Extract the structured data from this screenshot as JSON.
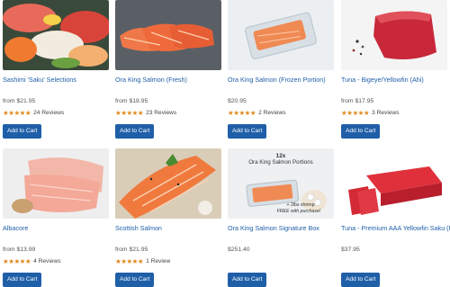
{
  "products": [
    {
      "name": "Sashimi 'Saku' Selections",
      "price": "from $21.95",
      "stars": "★★★★★",
      "reviews": "24 Reviews",
      "button": "Add to Cart"
    },
    {
      "name": "Ora King Salmon (Fresh)",
      "price": "from $18.95",
      "stars": "★★★★★",
      "reviews": "23 Reviews",
      "button": "Add to Cart"
    },
    {
      "name": "Ora King Salmon (Frozen Portion)",
      "price": "$20.95",
      "stars": "★★★★★",
      "reviews": "2 Reviews",
      "button": "Add to Cart"
    },
    {
      "name": "Tuna - Bigeye/Yellowfin (Ahi)",
      "price": "from $17.95",
      "stars": "★★★★★",
      "reviews": "3 Reviews",
      "button": "Add to Cart"
    },
    {
      "name": "Albacore",
      "price": "from $13.99",
      "stars": "★★★★★",
      "reviews": "4 Reviews",
      "button": "Add to Cart"
    },
    {
      "name": "Scottish Salmon",
      "price": "from $21.95",
      "stars": "★★★★★",
      "reviews": "1 Review",
      "button": "Add to Cart"
    },
    {
      "name": "Ora King Salmon Signature Box",
      "price": "$251.40",
      "button": "Add to Cart",
      "promo": {
        "qty": "12x",
        "title": "Ora King Salmon Portions",
        "offer": "+ 2lbs shrimp",
        "note": "FREE with purchase!"
      }
    },
    {
      "name": "Tuna - Premium AAA Yellowfin Saku (Frozen)",
      "price": "$37.95",
      "button": "Add to Cart"
    }
  ],
  "colors": {
    "link": "#1f5fa8",
    "button": "#1f5fa8",
    "stars": "#e08a1e"
  }
}
